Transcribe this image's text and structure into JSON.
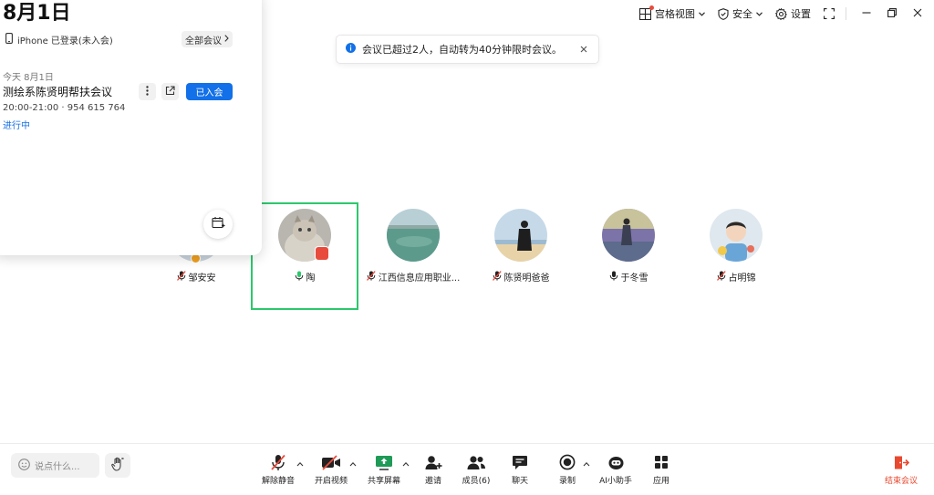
{
  "topbar": {
    "view_label": "宫格视图",
    "security_label": "安全",
    "settings_label": "设置"
  },
  "notice": {
    "text": "会议已超过2人，自动转为40分钟限时会议。"
  },
  "panel": {
    "date": "8月1日",
    "login_status": "iPhone 已登录(未入会)",
    "all_meetings_label": "全部会议",
    "today_label": "今天 8月1日",
    "meeting": {
      "title": "测绘系陈贤明帮扶会议",
      "time_id": "20:00-21:00 · 954 615 764",
      "status": "进行中",
      "joined_label": "已入会"
    }
  },
  "participants": [
    {
      "name": "邹安安",
      "mic": "muted"
    },
    {
      "name": "陶",
      "mic": "active"
    },
    {
      "name": "江西信息应用职业...",
      "mic": "muted"
    },
    {
      "name": "陈贤明爸爸",
      "mic": "muted"
    },
    {
      "name": "于冬雪",
      "mic": "on"
    },
    {
      "name": "占明锦",
      "mic": "muted"
    }
  ],
  "bottombar": {
    "chat_placeholder": "说点什么...",
    "tools": {
      "unmute": "解除静音",
      "video": "开启视频",
      "share": "共享屏幕",
      "invite": "邀请",
      "members": "成员(6)",
      "chat": "聊天",
      "record": "录制",
      "ai": "AI小助手",
      "apps": "应用",
      "end": "结束会议"
    }
  },
  "colors": {
    "accent": "#1270e8",
    "active_speaker": "#2dc76d",
    "end_meeting": "#e8482f",
    "status_link": "#1a6fe6"
  }
}
